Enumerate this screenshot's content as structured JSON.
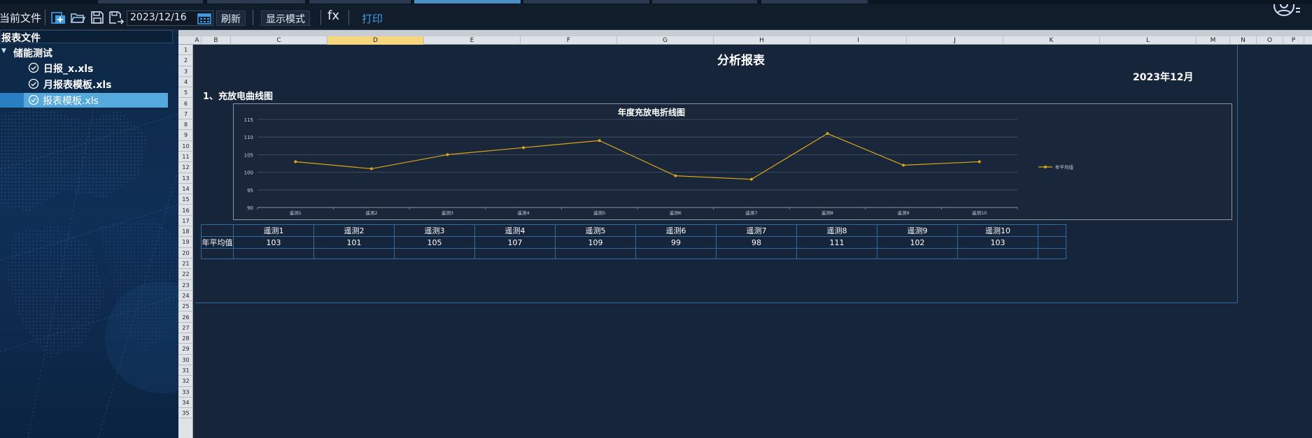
{
  "toolbar": {
    "current_file_label": "当前文件",
    "date_value": "2023/12/16",
    "refresh_label": "刷新",
    "display_mode_label": "显示模式",
    "fx_label": "fx",
    "print_label": "打印",
    "icons": [
      "add-file-icon",
      "open-folder-icon",
      "save-icon",
      "save-as-icon",
      "calendar-icon",
      "user-icon"
    ]
  },
  "sidebar": {
    "header": "报表文件",
    "folder": "储能测试",
    "items": [
      {
        "label": "日报_x.xls",
        "selected": false
      },
      {
        "label": "月报表模板.xls",
        "selected": false
      },
      {
        "label": "报表模板.xls",
        "selected": true
      }
    ]
  },
  "sheet": {
    "columns": [
      "A",
      "B",
      "C",
      "D",
      "E",
      "F",
      "G",
      "H",
      "I",
      "J",
      "K",
      "L",
      "M",
      "N",
      "O",
      "P"
    ],
    "selected_column": "D",
    "rows": [
      "1",
      "2",
      "3",
      "4",
      "5",
      "6",
      "7",
      "8",
      "9",
      "10",
      "11",
      "12",
      "13",
      "14",
      "15",
      "16",
      "17",
      "18",
      "19",
      "20",
      "21",
      "22",
      "23",
      "24",
      "25",
      "26",
      "27",
      "28",
      "29",
      "30",
      "31",
      "32",
      "33",
      "34",
      "35"
    ]
  },
  "report": {
    "title": "分析报表",
    "date": "2023年12月",
    "section_title": "1、充放电曲线图",
    "table_row_label": "年平均值"
  },
  "chart_data": {
    "type": "line",
    "title": "年度充放电折线图",
    "categories": [
      "遥测1",
      "遥测2",
      "遥测3",
      "遥测4",
      "遥测5",
      "遥测6",
      "遥测7",
      "遥测8",
      "遥测9",
      "遥测10"
    ],
    "series": [
      {
        "name": "年平均值",
        "values": [
          103,
          101,
          105,
          107,
          109,
          99,
          98,
          111,
          102,
          103
        ],
        "color": "#d9a818"
      }
    ],
    "ylim": [
      90,
      115
    ],
    "yticks": [
      90,
      95,
      100,
      105,
      110,
      115
    ],
    "grid": true,
    "legend": "right"
  }
}
